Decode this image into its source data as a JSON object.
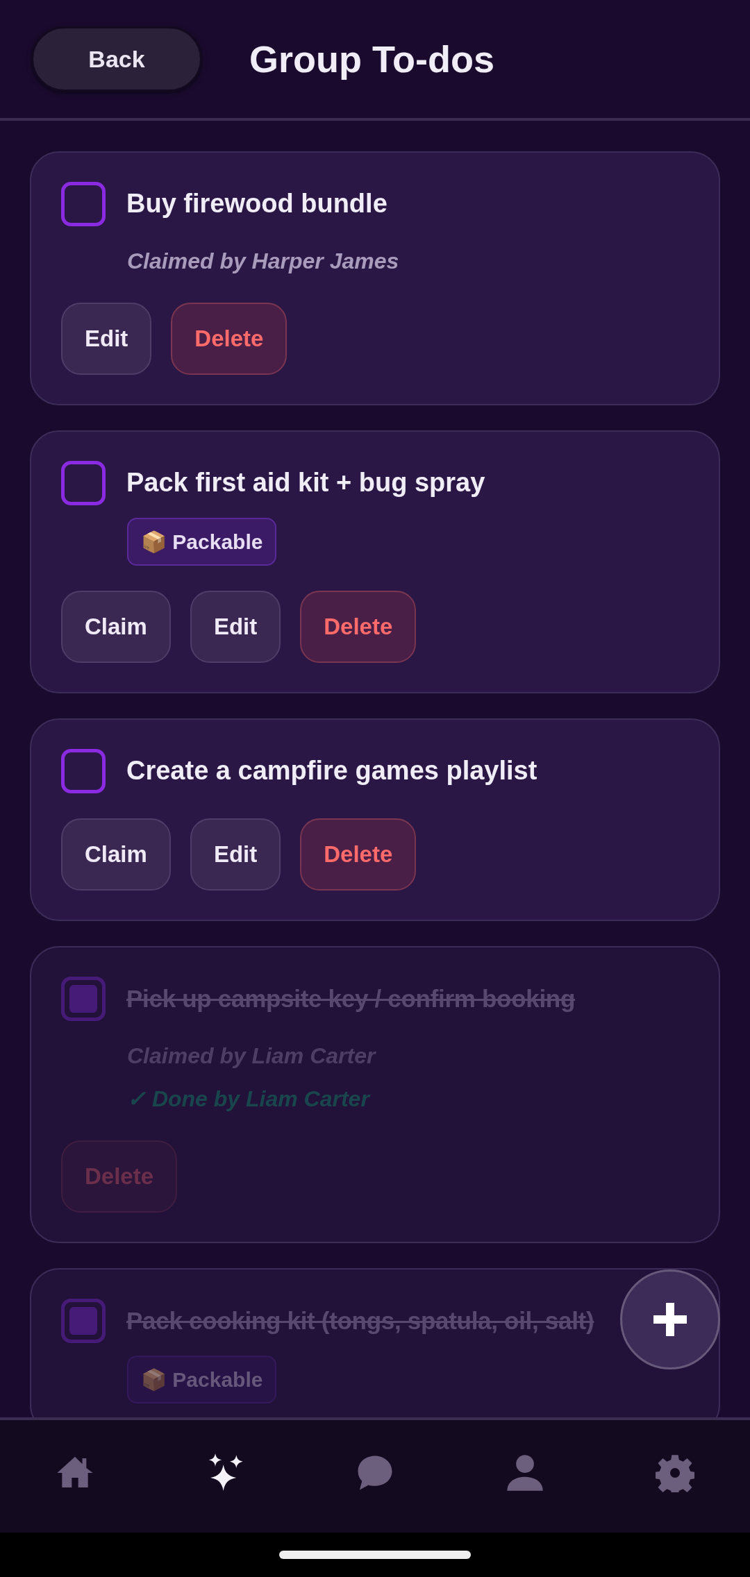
{
  "header": {
    "back_button": "Back",
    "title": "Group To-dos"
  },
  "todos": [
    {
      "title": "Buy firewood bundle",
      "done": false,
      "claimed": "Claimed by Harper James",
      "buttons": [
        {
          "label": "Edit",
          "kind": "edit"
        },
        {
          "label": "Delete",
          "kind": "delete"
        }
      ]
    },
    {
      "title": "Pack first aid kit + bug spray",
      "done": false,
      "tag": "📦 Packable",
      "buttons": [
        {
          "label": "Claim",
          "kind": "claim"
        },
        {
          "label": "Edit",
          "kind": "edit"
        },
        {
          "label": "Delete",
          "kind": "delete"
        }
      ]
    },
    {
      "title": "Create a campfire games playlist",
      "done": false,
      "buttons": [
        {
          "label": "Claim",
          "kind": "claim"
        },
        {
          "label": "Edit",
          "kind": "edit"
        },
        {
          "label": "Delete",
          "kind": "delete"
        }
      ]
    },
    {
      "title": "Pick up campsite key / confirm booking",
      "done": true,
      "claimed": "Claimed by Liam Carter",
      "done_by": "✓ Done by Liam Carter",
      "buttons": [
        {
          "label": "Delete",
          "kind": "delete"
        }
      ]
    },
    {
      "title": "Pack cooking kit (tongs, spatula, oil, salt)",
      "done": true,
      "tag": "📦 Packable"
    }
  ],
  "nav": [
    {
      "kind": "home",
      "selected": false
    },
    {
      "kind": "sparkles",
      "selected": true
    },
    {
      "kind": "chat",
      "selected": false
    },
    {
      "kind": "person",
      "selected": false
    },
    {
      "kind": "settings",
      "selected": false
    }
  ]
}
